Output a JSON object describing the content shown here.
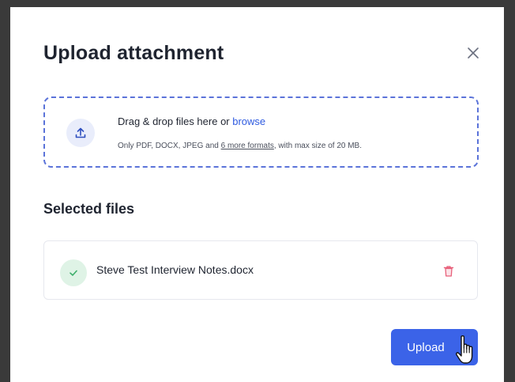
{
  "dialog": {
    "title": "Upload attachment",
    "close_icon": "close-icon"
  },
  "dropzone": {
    "icon": "upload-icon",
    "main_text": "Drag & drop files here or ",
    "browse_link": "browse",
    "sub_text_prefix": "Only PDF, DOCX, JPEG and ",
    "more_formats_link": "6 more formats",
    "sub_text_suffix": ", with max size of 20 MB."
  },
  "selected_files": {
    "title": "Selected files",
    "items": [
      {
        "name": "Steve Test Interview Notes.docx",
        "status_icon": "check-icon",
        "delete_icon": "trash-icon"
      }
    ]
  },
  "actions": {
    "upload_label": "Upload"
  },
  "colors": {
    "primary": "#3b63e8",
    "link": "#2f5be0",
    "success_bg": "#dff3e6",
    "success": "#3cae6a",
    "danger": "#e8607a"
  }
}
